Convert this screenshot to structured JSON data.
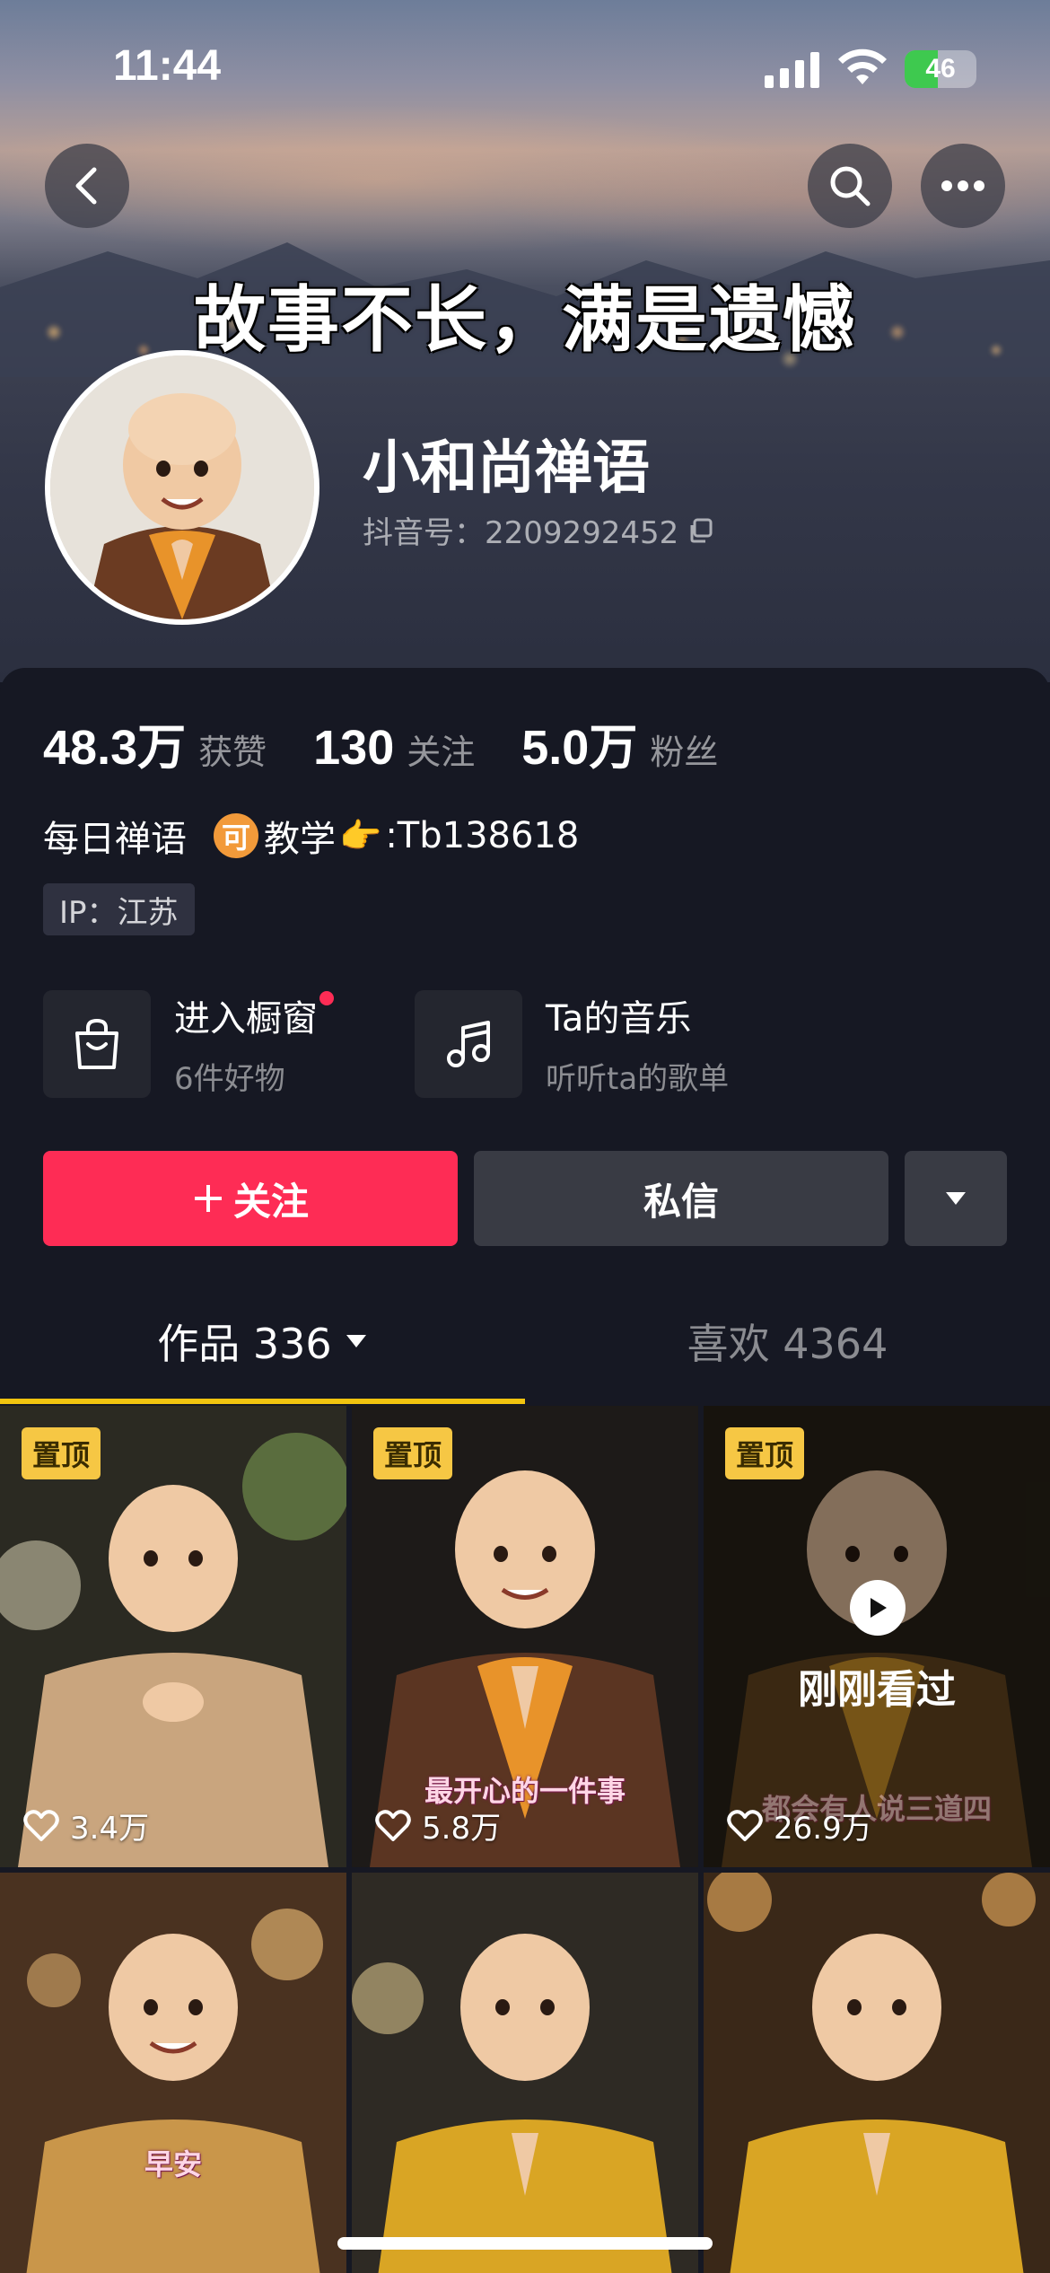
{
  "status_bar": {
    "time": "11:44",
    "battery": "46",
    "battery_level": 0.46
  },
  "header": {
    "banner_text": "故事不长，满是遗憾"
  },
  "profile": {
    "name": "小和尚禅语",
    "douyin_id": "抖音号：2209292452"
  },
  "stats": [
    {
      "num": "48.3万",
      "label": "获赞"
    },
    {
      "num": "130",
      "label": "关注"
    },
    {
      "num": "5.0万",
      "label": "粉丝"
    }
  ],
  "bio": {
    "part1": "每日禅语",
    "coin": "可",
    "part2": "教学",
    "hand": "👉",
    "part3": ":Tb138618"
  },
  "ip": "IP：江苏",
  "features": {
    "shop": {
      "title": "进入橱窗",
      "subtitle": "6件好物"
    },
    "music": {
      "title": "Ta的音乐",
      "subtitle": "听听ta的歌单"
    }
  },
  "actions": {
    "follow": "关注",
    "message": "私信"
  },
  "tabs": {
    "works": "作品 336",
    "likes": "喜欢 4364"
  },
  "videos": [
    {
      "pinned": "置顶",
      "likes": "3.4万",
      "caption": ""
    },
    {
      "pinned": "置顶",
      "likes": "5.8万",
      "caption": "最开心的一件事"
    },
    {
      "pinned": "置顶",
      "likes": "26.9万",
      "caption": "都会有人说三道四",
      "watched": "刚刚看过"
    },
    {
      "caption": "早安"
    },
    {
      "caption": ""
    },
    {
      "caption": ""
    }
  ],
  "colors": {
    "accent": "#fe2c55",
    "pin": "#f6c744",
    "tab_underline": "#f1c40f",
    "background": "#161823"
  }
}
